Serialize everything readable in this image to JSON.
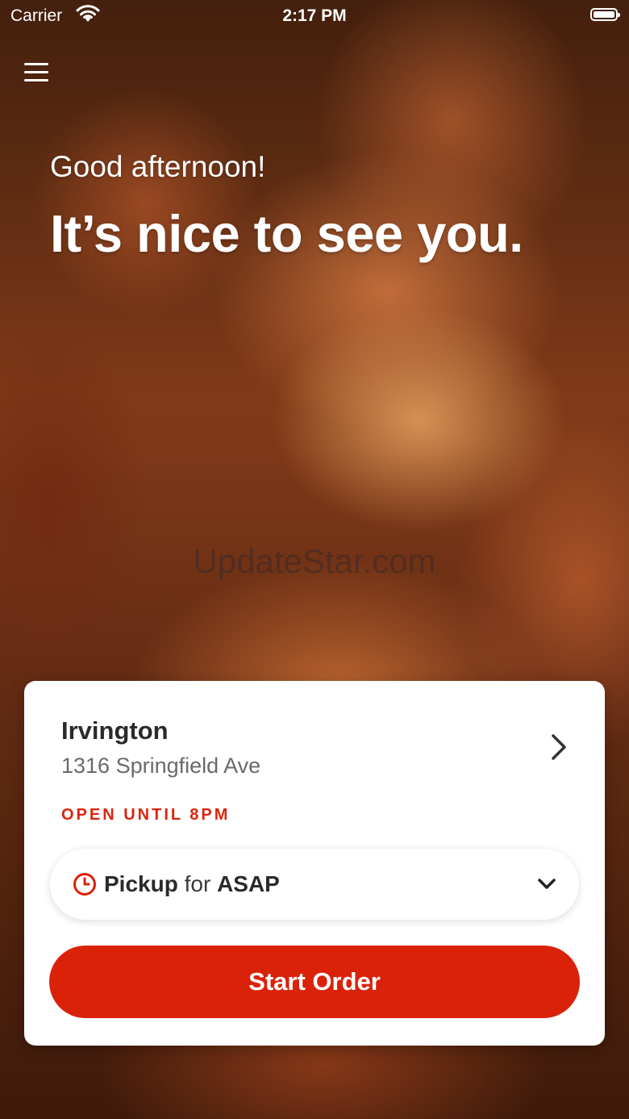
{
  "status_bar": {
    "carrier": "Carrier",
    "time": "2:17 PM",
    "battery_level": 1.0
  },
  "header": {
    "menu_icon": "hamburger-menu-icon"
  },
  "hero": {
    "greeting": "Good afternoon!",
    "headline": "It’s nice to see you.",
    "watermark": "UpdateStar.com"
  },
  "store_card": {
    "store_name": "Irvington",
    "address": "1316 Springfield Ave",
    "hours": "OPEN UNTIL 8PM",
    "order_mode": {
      "mode": "Pickup",
      "connector": "for",
      "time": "ASAP"
    },
    "start_button": "Start Order"
  },
  "colors": {
    "accent": "#da2209",
    "hours_text": "#d9260d",
    "card_background": "#ffffff"
  }
}
